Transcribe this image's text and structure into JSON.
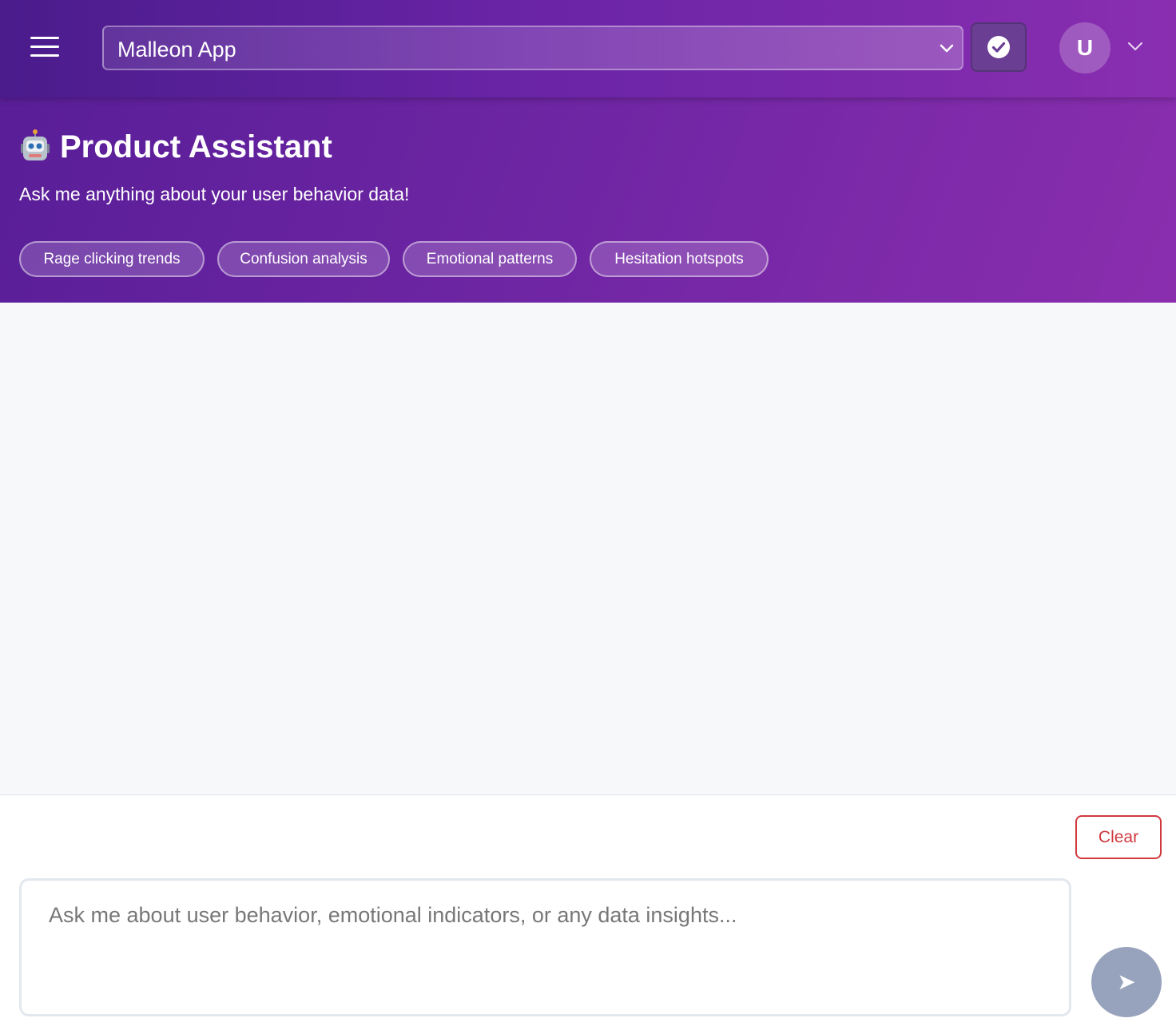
{
  "header": {
    "menu_icon": "hamburger-menu-icon",
    "app_selector": {
      "value": "Malleon App",
      "icon": "chevron-down-icon"
    },
    "confirm_icon": "check-circle-icon",
    "avatar_initial": "U",
    "user_menu_icon": "chevron-down-icon"
  },
  "hero": {
    "icon": "robot-emoji-icon",
    "title": "Product Assistant",
    "subtitle": "Ask me anything about your user behavior data!",
    "suggestions": [
      "Rage clicking trends",
      "Confusion analysis",
      "Emotional patterns",
      "Hesitation hotspots"
    ]
  },
  "composer": {
    "clear_label": "Clear",
    "placeholder": "Ask me about user behavior, emotional indicators, or any data insights...",
    "send_label": "➤"
  },
  "colors": {
    "brand_purple_dark": "#4a1c8c",
    "brand_purple_light": "#8a2eb0",
    "danger": "#d0393e",
    "send_disabled": "#97a3bc"
  }
}
